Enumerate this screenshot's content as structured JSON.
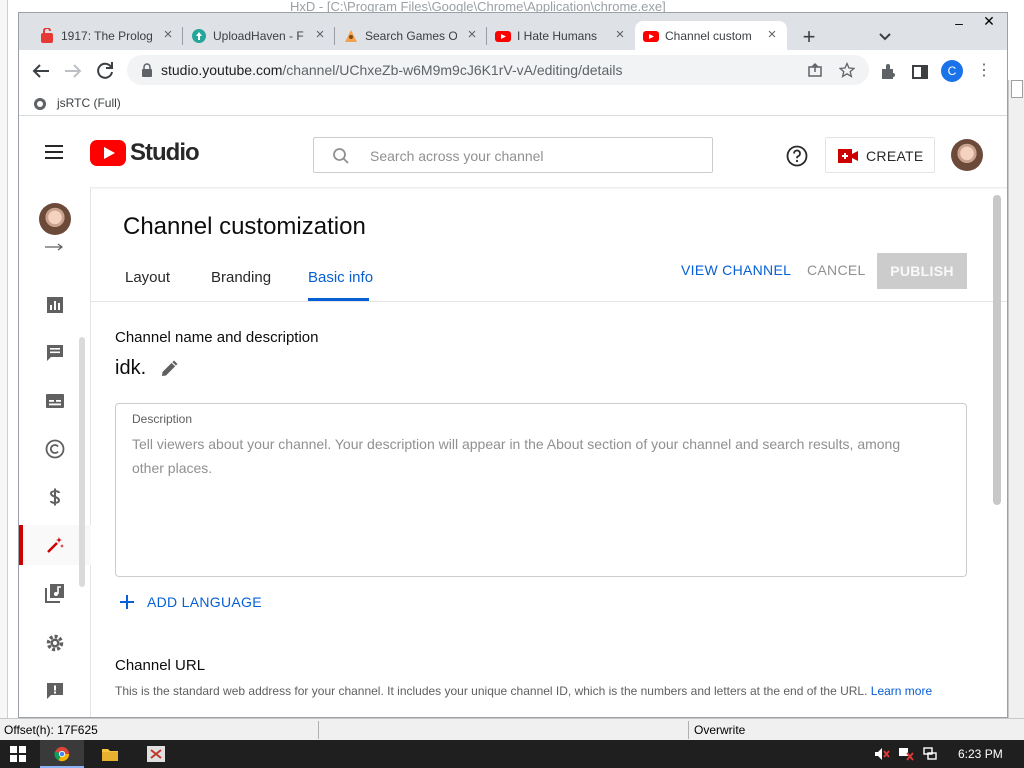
{
  "bg_app": {
    "title": "HxD - [C:\\Program Files\\Google\\Chrome\\Application\\chrome.exe]",
    "status_offset": "Offset(h): 17F625",
    "status_mode": "Overwrite"
  },
  "browser": {
    "tabs": [
      {
        "label": "1917: The Prolog",
        "favicon": "red-app-icon"
      },
      {
        "label": "UploadHaven - F",
        "favicon": "uploadhaven-icon"
      },
      {
        "label": "Search Games O",
        "favicon": "game-icon"
      },
      {
        "label": "I Hate Humans",
        "favicon": "youtube-icon"
      },
      {
        "label": "Channel custom",
        "favicon": "youtube-icon"
      }
    ],
    "url_host": "studio.youtube.com",
    "url_path": "/channel/UChxeZb-w6M9m9cJ6K1rV-vA/editing/details",
    "profile_initial": "C",
    "bookmark": "jsRTC (Full)"
  },
  "studio": {
    "logo_text": "Studio",
    "search_placeholder": "Search across your channel",
    "create_label": "CREATE",
    "page_title": "Channel customization",
    "tabs": [
      "Layout",
      "Branding",
      "Basic info"
    ],
    "view_channel": "VIEW CHANNEL",
    "cancel": "CANCEL",
    "publish": "PUBLISH",
    "section1_title": "Channel name and description",
    "channel_name": "idk.",
    "description_label": "Description",
    "description_placeholder": "Tell viewers about your channel. Your description will appear in the About section of your channel and search results, among other places.",
    "add_language": "ADD LANGUAGE",
    "section2_title": "Channel URL",
    "section2_desc": "This is the standard web address for your channel. It includes your unique channel ID, which is the numbers and letters at the end of the URL.",
    "learn_more": "Learn more"
  },
  "taskbar": {
    "clock": "6:23 PM"
  },
  "colors": {
    "accent_blue": "#065fd4",
    "youtube_red": "#ff0000",
    "active_nav": "#cc0000"
  }
}
